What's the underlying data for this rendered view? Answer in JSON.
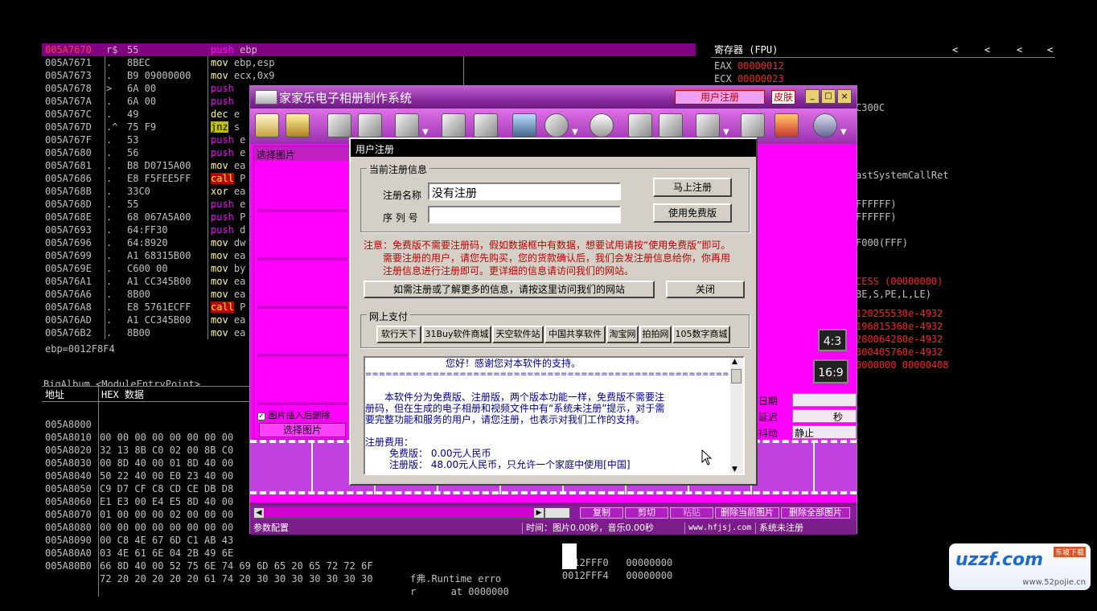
{
  "code_rows": [
    {
      "addr": "005A7670",
      "mark": "r$",
      "hex": "55",
      "asm": "push ebp",
      "sel": true
    },
    {
      "addr": "005A7671",
      "mark": ".",
      "hex": "8BEC",
      "asm": "mov ebp,esp"
    },
    {
      "addr": "005A7673",
      "mark": ".",
      "hex": "B9 09000000",
      "asm": "mov ecx,0x9"
    },
    {
      "addr": "005A7678",
      "mark": ">",
      "hex": "6A 00",
      "asm": "push"
    },
    {
      "addr": "005A767A",
      "mark": ".",
      "hex": "6A 00",
      "asm": "push"
    },
    {
      "addr": "005A767C",
      "mark": ".",
      "hex": "49",
      "asm": "dec e"
    },
    {
      "addr": "005A767D",
      "mark": ".^",
      "hex": "75 F9",
      "asm": "jnz s"
    },
    {
      "addr": "005A767F",
      "mark": ".",
      "hex": "53",
      "asm": "push e"
    },
    {
      "addr": "005A7680",
      "mark": ".",
      "hex": "56",
      "asm": "push e"
    },
    {
      "addr": "005A7681",
      "mark": ".",
      "hex": "B8 D0715A00",
      "asm": "mov ea"
    },
    {
      "addr": "005A7686",
      "mark": ".",
      "hex": "E8 F5FEE5FF",
      "asm": "call P"
    },
    {
      "addr": "005A768B",
      "mark": ".",
      "hex": "33C0",
      "asm": "xor ea"
    },
    {
      "addr": "005A768D",
      "mark": ".",
      "hex": "55",
      "asm": "push e"
    },
    {
      "addr": "005A768E",
      "mark": ".",
      "hex": "68 067A5A00",
      "asm": "push P"
    },
    {
      "addr": "005A7693",
      "mark": ".",
      "hex": "64:FF30",
      "asm": "push d"
    },
    {
      "addr": "005A7696",
      "mark": ".",
      "hex": "64:8920",
      "asm": "mov dw"
    },
    {
      "addr": "005A7699",
      "mark": ".",
      "hex": "A1 68315B00",
      "asm": "mov ea"
    },
    {
      "addr": "005A769E",
      "mark": ".",
      "hex": "C600 00",
      "asm": "mov by"
    },
    {
      "addr": "005A76A1",
      "mark": ".",
      "hex": "A1 CC345B00",
      "asm": "mov ea"
    },
    {
      "addr": "005A76A6",
      "mark": ".",
      "hex": "8B00",
      "asm": "mov ea"
    },
    {
      "addr": "005A76A8",
      "mark": ".",
      "hex": "E8 5761ECFF",
      "asm": "call P"
    },
    {
      "addr": "005A76AD",
      "mark": ".",
      "hex": "A1 CC345B00",
      "asm": "mov ea"
    },
    {
      "addr": "005A76B2",
      "mark": ".",
      "hex": "8B00",
      "asm": "mov ea"
    }
  ],
  "ebp_line": "ebp=0012F8F4",
  "module_line": "BigAlbum.<ModuleEntryPoint>",
  "registers": {
    "header": "寄存器 (FPU)",
    "lines": [
      {
        "text": "EAX",
        "val": "00000012",
        "red": true
      },
      {
        "text": "ECX",
        "val": "00000023",
        "red": true
      },
      {
        "text": "",
        "val": "C300C"
      },
      {
        "text": "",
        "val": "astSystemCallRet"
      },
      {
        "text": "",
        "val": "FFFFFF)"
      },
      {
        "text": "",
        "val": "FFFFFF)"
      },
      {
        "text": "",
        "val": "F000(FFF)"
      },
      {
        "text": "",
        "val": "CESS (00000000)",
        "red": true
      },
      {
        "text": "",
        "val": "BE,S,PE,L,LE)"
      },
      {
        "text": "",
        "val": "120255530e-4932",
        "red": true
      },
      {
        "text": "",
        "val": "196815360e-4932",
        "red": true
      },
      {
        "text": "",
        "val": "280064280e-4932",
        "red": true
      },
      {
        "text": "",
        "val": "300405760e-4932",
        "red": true
      },
      {
        "text": "",
        "val": "0000000 00000408",
        "red": true
      }
    ]
  },
  "hex_panel": {
    "col1": "地址",
    "col2": "HEX 数据",
    "rows": [
      {
        "addr": "005A8000",
        "hex": "00 00 00 00 00 00 00 00"
      },
      {
        "addr": "005A8010",
        "hex": "32 13 8B C0 02 00 8B C0"
      },
      {
        "addr": "005A8020",
        "hex": "00 8D 40 00 01 8D 40 00"
      },
      {
        "addr": "005A8030",
        "hex": "50 22 40 00 E0 23 40 00"
      },
      {
        "addr": "005A8040",
        "hex": "C9 D7 CF C8 CD CE DB D8"
      },
      {
        "addr": "005A8050",
        "hex": "E1 E3 00 E4 E5 8D 40 00"
      },
      {
        "addr": "005A8060",
        "hex": "01 00 00 00 02 00 00 00"
      },
      {
        "addr": "005A8070",
        "hex": "00 00 00 00 00 00 00 00"
      },
      {
        "addr": "005A8080",
        "hex": "00 C8 4E 67 6D C1 AB 43"
      },
      {
        "addr": "005A8090",
        "hex": "03 4E 61 6E 04 2B 49 6E"
      },
      {
        "addr": "005A80A0",
        "hex": "66 8D 40 00 52 75 6E 74 69 6D 65 20 65 72 72 6F",
        "ascii": "f弗.Runtime erro"
      },
      {
        "addr": "005A80B0",
        "hex": "72 20 20 20 20 20 61 74 20 30 30 30 30 30 30 30",
        "ascii": "r      at 0000000"
      }
    ]
  },
  "stack": [
    {
      "addr": "0012FFF0",
      "val": "00000000"
    },
    {
      "addr": "0012FFF4",
      "val": "00000000"
    }
  ],
  "app": {
    "title": "家家乐电子相册制作系统",
    "register_link": "用户注册",
    "skin_btn": "皮肤",
    "select_pic_label": "选择图片",
    "delete_after_insert": "图片插入后删除",
    "select_pic_btn": "选择图片",
    "ratio_43": "4:3",
    "ratio_169": "16:9",
    "right_fields": [
      {
        "label": "日期",
        "value": ""
      },
      {
        "label": "延迟",
        "value": "秒"
      },
      {
        "label": "抖动",
        "value": "静止"
      }
    ],
    "bottom_btns": [
      "复制",
      "剪切",
      "粘贴",
      "删除当前图片",
      "删除全部图片"
    ],
    "status": {
      "config": "参数配置",
      "time": "时间：图片0.00秒，音乐0.00秒",
      "site": "www.hfjsj.com",
      "reg": "系统未注册"
    }
  },
  "dialog": {
    "title": "用户注册",
    "group1": "当前注册信息",
    "name_label": "注册名称",
    "name_value": "没有注册",
    "serial_label": "序 列 号",
    "serial_value": "",
    "btn_register": "马上注册",
    "btn_free": "使用免费版",
    "note_lines": [
      "注意：免费版不需要注册码，假如数据框中有数据，想要试用请按“使用免费版”即可。",
      "需要注册的用户，请您先购买，您的货款确认后，我们会发注册信息给你，你再用",
      "注册信息进行注册即可。更详细的信息请访问我们的网站。"
    ],
    "btn_website": "如需注册或了解更多的信息，请按这里访问我们的网站",
    "btn_close": "关闭",
    "group2": "网上支付",
    "shops": [
      "软行天下",
      "31Buy软件商城",
      "天空软件站",
      "中国共享软件",
      "淘宝网",
      "拍拍网",
      "105数字商城"
    ],
    "info_lines": [
      "您好！感谢您对本软件的支持。",
      "======================================================",
      "",
      "本软件分为免费版、注册版，两个版本功能一样，免费版不需要注",
      "册码，但在生成的电子相册和视频文件中有“系统未注册”提示，对于需",
      "要完整功能和服务的用户，请您注册，也表示对我们工作的支持。",
      "",
      "注册费用：",
      "免费版：  0.00元人民币",
      "注册版：  48.00元人民币，只允许一个家庭中使用[中国]"
    ]
  },
  "watermark": {
    "logo": "uzzf.com",
    "sub": "东坡下载",
    "url": "www.52pojie.cn"
  }
}
